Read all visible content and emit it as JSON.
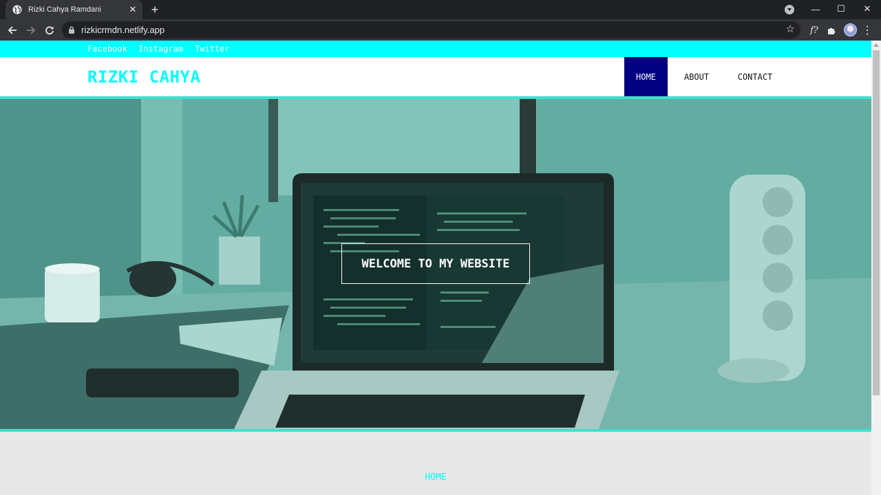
{
  "browser": {
    "tab_title": "Rizki Cahya Ramdani",
    "tab_close": "✕",
    "new_tab": "+",
    "url": "rizkicrmdn.netlify.app",
    "bookmark_icon": "☆",
    "ext_font_label": "f?",
    "ext_puzzle_icon": "puzzle-icon",
    "menu_icon": "⋮",
    "minimize": "—",
    "maximize": "☐",
    "close": "✕"
  },
  "site": {
    "social_links": [
      {
        "label": "Facebook"
      },
      {
        "label": "Instagram"
      },
      {
        "label": "Twitter"
      }
    ],
    "brand": "RIZKI CAHYA",
    "nav": [
      {
        "label": "HOME",
        "active": true
      },
      {
        "label": "ABOUT",
        "active": false
      },
      {
        "label": "CONTACT",
        "active": false
      }
    ],
    "hero": {
      "headline": "WELCOME TO MY WEBSITE"
    },
    "section_title": "HOME"
  },
  "colors": {
    "accent": "#00ffff",
    "nav_active": "#000080",
    "divider": "#40e0d0",
    "hero_overlay": "#5aa79d"
  }
}
